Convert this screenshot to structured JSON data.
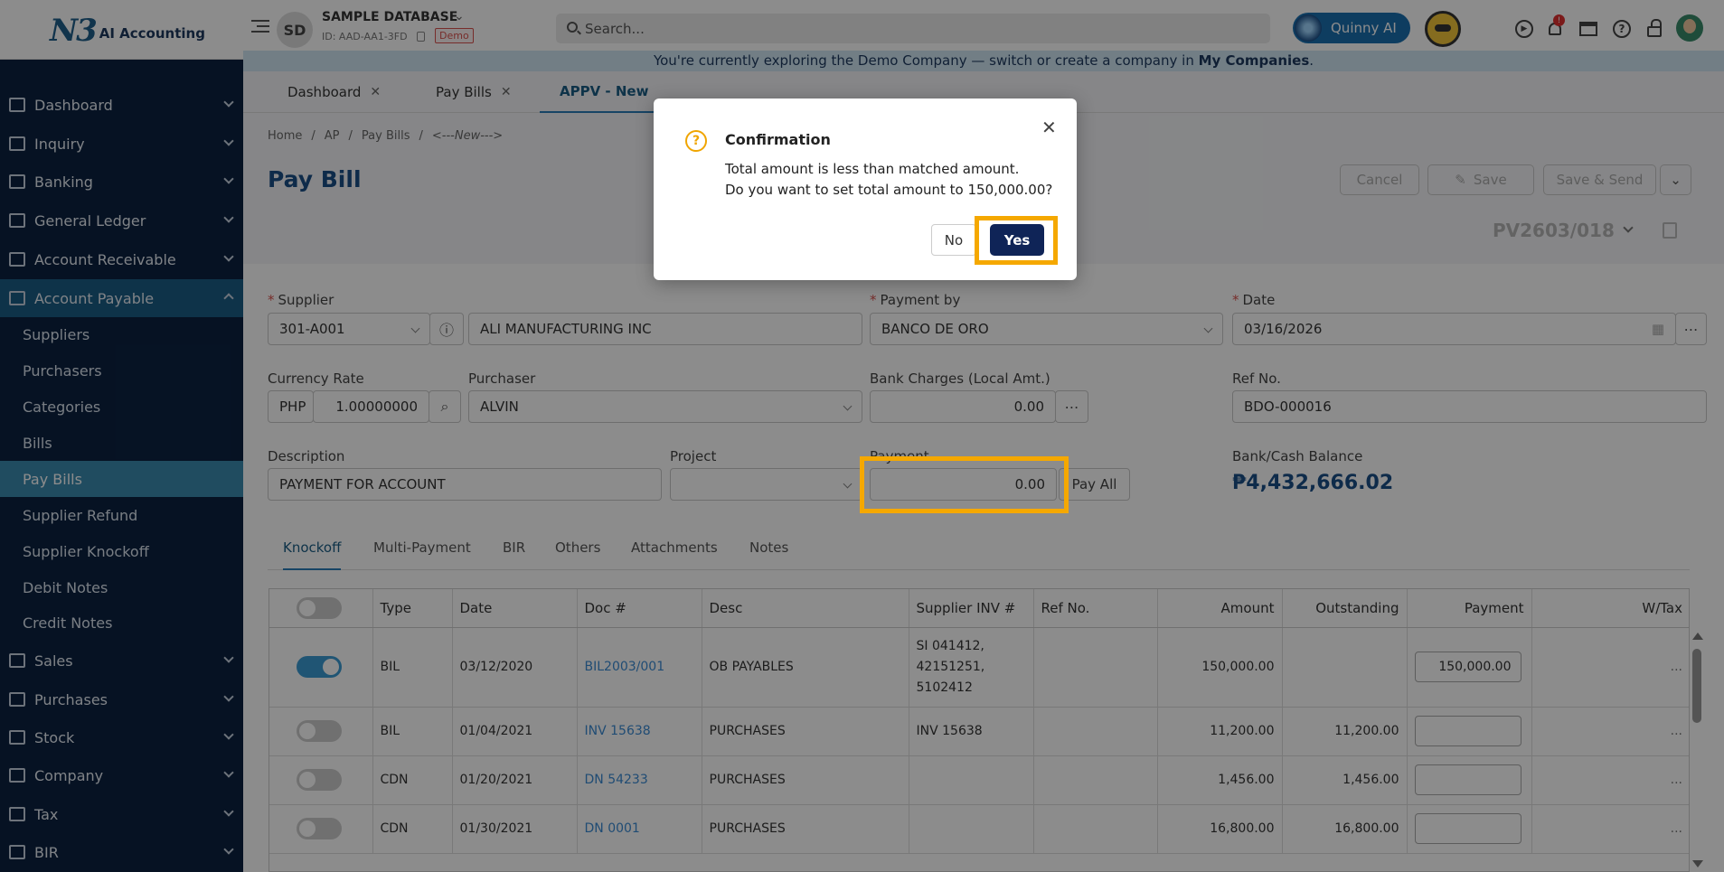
{
  "app": {
    "logo_mark": "N3",
    "logo_text": "AI Accounting",
    "avatar_initials": "SD",
    "db_name": "SAMPLE DATABASE",
    "db_id": "ID: AAD-AA1-3FD",
    "demo_badge": "Demo",
    "search_placeholder": "Search...",
    "ai_label": "Quinny AI",
    "notification_count": "!"
  },
  "banner": {
    "text": "You're currently exploring the Demo Company — switch or create a company in ",
    "link": "My Companies",
    "end": "."
  },
  "sidebar": {
    "items": [
      {
        "label": "Dashboard"
      },
      {
        "label": "Inquiry"
      },
      {
        "label": "Banking"
      },
      {
        "label": "General Ledger"
      },
      {
        "label": "Account Receivable"
      },
      {
        "label": "Account Payable"
      }
    ],
    "sub_items": [
      {
        "label": "Suppliers"
      },
      {
        "label": "Purchasers"
      },
      {
        "label": "Categories"
      },
      {
        "label": "Bills"
      },
      {
        "label": "Pay Bills"
      },
      {
        "label": "Supplier Refund"
      },
      {
        "label": "Supplier Knockoff"
      },
      {
        "label": "Debit Notes"
      },
      {
        "label": "Credit Notes"
      }
    ],
    "items_after": [
      {
        "label": "Sales"
      },
      {
        "label": "Purchases"
      },
      {
        "label": "Stock"
      },
      {
        "label": "Company"
      },
      {
        "label": "Tax"
      },
      {
        "label": "BIR"
      }
    ]
  },
  "tabs": [
    {
      "label": "Dashboard"
    },
    {
      "label": "Pay Bills"
    },
    {
      "label": "APPV - New"
    }
  ],
  "breadcrumb": {
    "home": "Home",
    "ap": "AP",
    "pay_bills": "Pay Bills",
    "current": "<---New--->"
  },
  "page": {
    "title": "Pay Bill",
    "cancel": "Cancel",
    "save": "Save",
    "save_send": "Save & Send",
    "doc_no": "PV2603/018"
  },
  "form": {
    "supplier_label": "Supplier",
    "supplier_code": "301-A001",
    "supplier_name": "ALI MANUFACTURING INC",
    "payment_by_label": "Payment by",
    "payment_by": "BANCO DE ORO",
    "date_label": "Date",
    "date": "03/16/2026",
    "currency_rate_label": "Currency Rate",
    "currency": "PHP",
    "rate": "1.00000000",
    "purchaser_label": "Purchaser",
    "purchaser": "ALVIN",
    "bank_charges_label": "Bank Charges (Local Amt.)",
    "bank_charges": "0.00",
    "ref_no_label": "Ref No.",
    "ref_no": "BDO-000016",
    "description_label": "Description",
    "description": "PAYMENT FOR ACCOUNT",
    "project_label": "Project",
    "project": "",
    "payment_label": "Payment",
    "payment": "0.00",
    "pay_all": "Pay All",
    "balance_label": "Bank/Cash Balance",
    "balance": "₱4,432,666.02"
  },
  "subtabs": [
    {
      "label": "Knockoff"
    },
    {
      "label": "Multi-Payment"
    },
    {
      "label": "BIR"
    },
    {
      "label": "Others"
    },
    {
      "label": "Attachments"
    },
    {
      "label": "Notes"
    }
  ],
  "table": {
    "headers": [
      "Type",
      "Date",
      "Doc #",
      "Desc",
      "Supplier INV #",
      "Ref No.",
      "Amount",
      "Outstanding",
      "Payment",
      "W/Tax"
    ],
    "rows": [
      {
        "on": true,
        "type": "BIL",
        "date": "03/12/2020",
        "doc": "BIL2003/001",
        "desc": "OB PAYABLES",
        "inv1": "SI 041412,",
        "inv2": "42151251,",
        "inv3": "5102412",
        "ref": "",
        "amount": "150,000.00",
        "outstanding": "",
        "payment": "150,000.00",
        "wtax": "..."
      },
      {
        "on": false,
        "type": "BIL",
        "date": "01/04/2021",
        "doc": "INV 15638",
        "desc": "PURCHASES",
        "inv1": "INV 15638",
        "ref": "",
        "amount": "11,200.00",
        "outstanding": "11,200.00",
        "payment": "",
        "wtax": "..."
      },
      {
        "on": false,
        "type": "CDN",
        "date": "01/20/2021",
        "doc": "DN 54233",
        "desc": "PURCHASES",
        "inv1": "",
        "ref": "",
        "amount": "1,456.00",
        "outstanding": "1,456.00",
        "payment": "",
        "wtax": "..."
      },
      {
        "on": false,
        "type": "CDN",
        "date": "01/30/2021",
        "doc": "DN 0001",
        "desc": "PURCHASES",
        "inv1": "",
        "ref": "",
        "amount": "16,800.00",
        "outstanding": "16,800.00",
        "payment": "",
        "wtax": "..."
      }
    ]
  },
  "dialog": {
    "title": "Confirmation",
    "line1": "Total amount is less than matched amount.",
    "line2": "Do you want to set total amount to 150,000.00?",
    "no": "No",
    "yes": "Yes"
  },
  "colors": {
    "sidebar": "#0b2241",
    "accent": "#1b4f88",
    "highlight": "#f5a800",
    "primary_button": "#0f2457"
  }
}
